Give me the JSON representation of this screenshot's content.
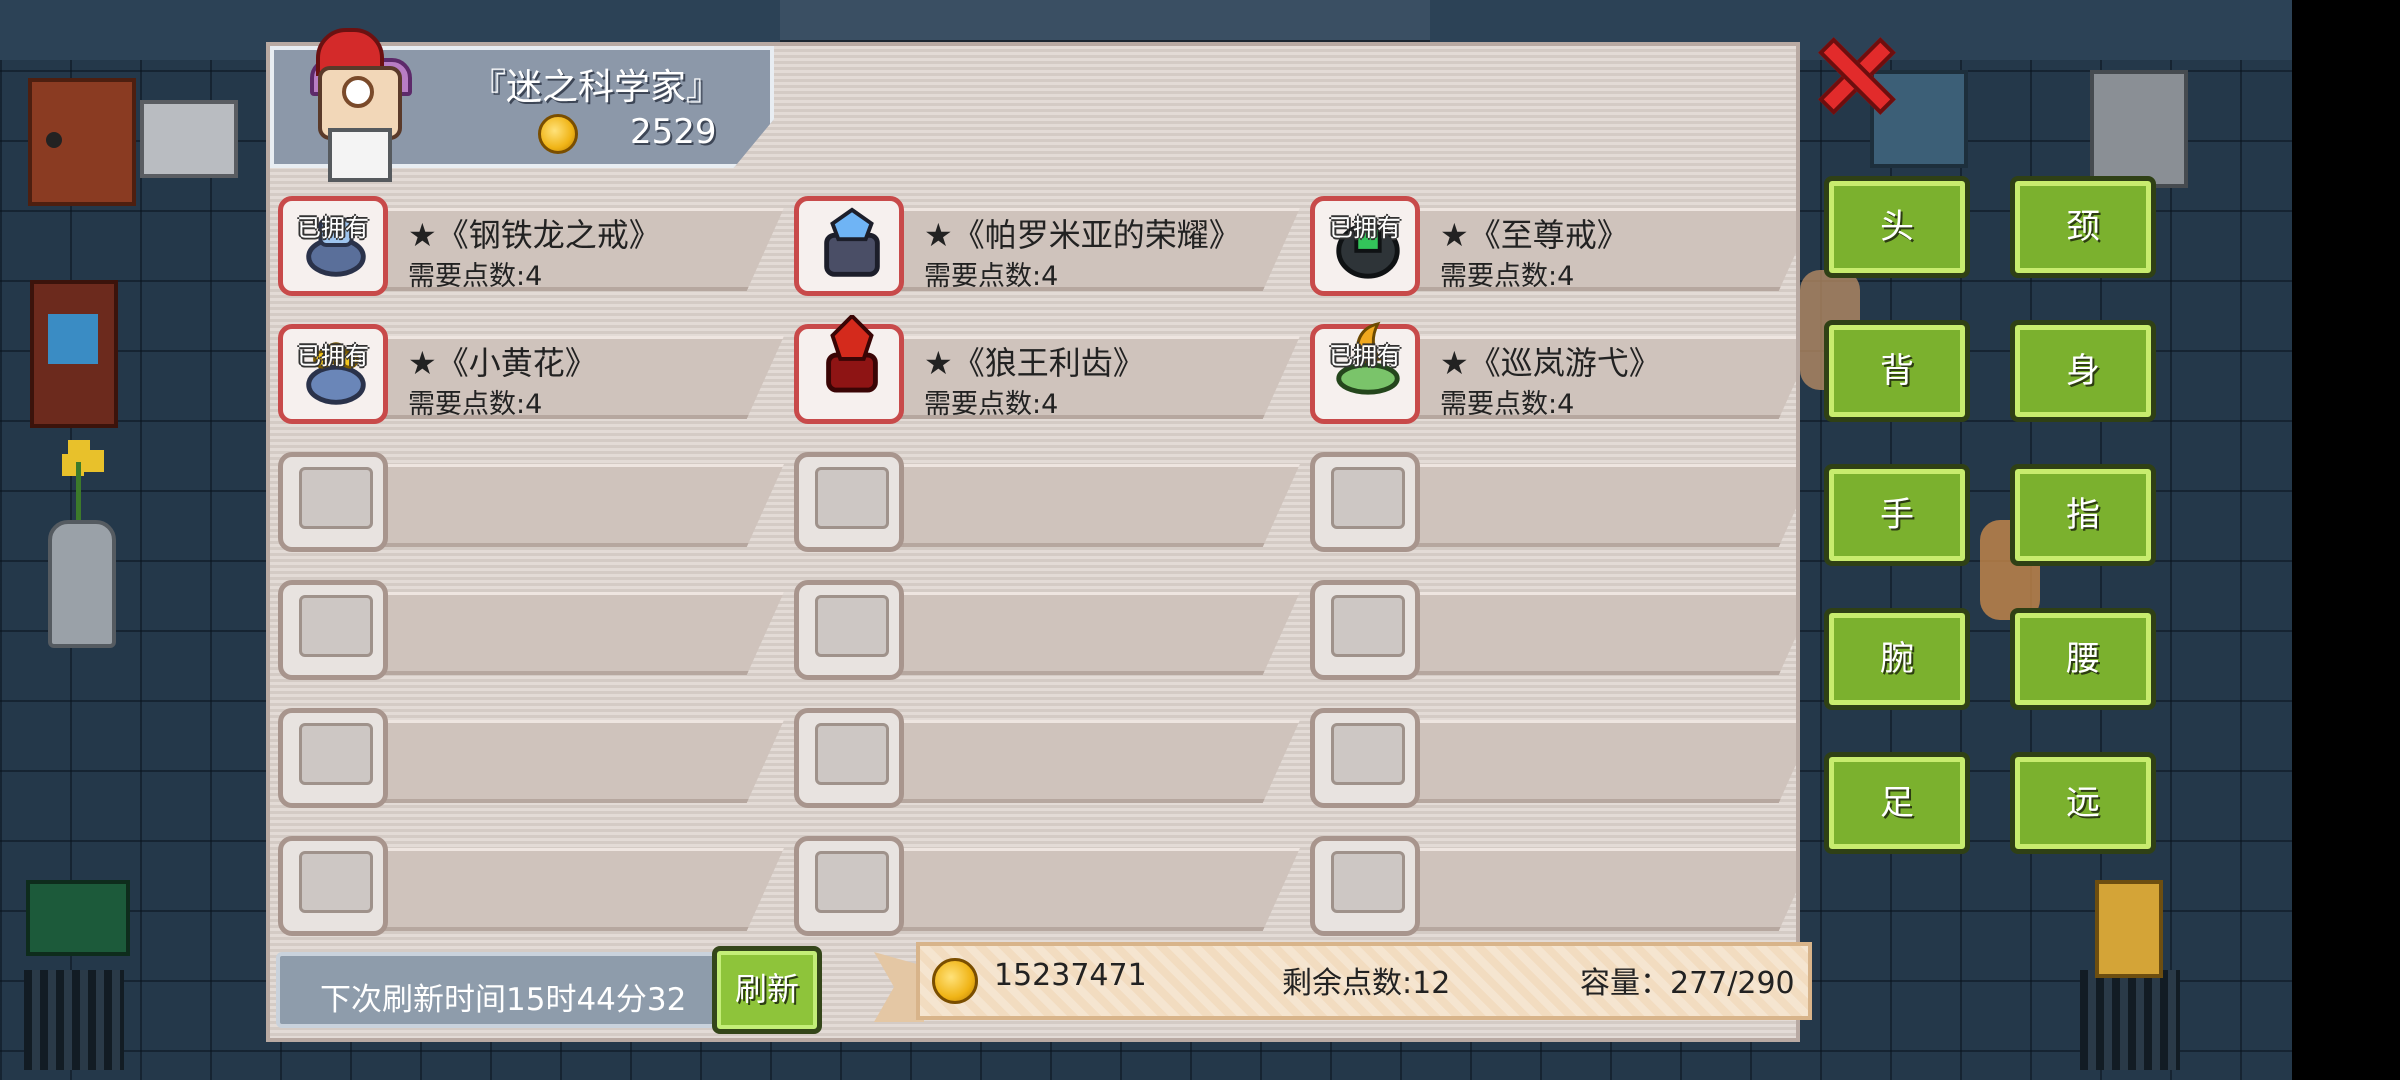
{
  "header": {
    "title": "『迷之科学家』",
    "gold": "2529"
  },
  "items": [
    {
      "name": "★《钢铁龙之戒》",
      "req": "需要点数:4",
      "owned_label": "已拥有",
      "owned": true,
      "icon": "steel-dragon-ring-icon",
      "color": "#7aa6d8"
    },
    {
      "name": "★《帕罗米亚的荣耀》",
      "req": "需要点数:4",
      "owned_label": "",
      "owned": false,
      "icon": "palomia-glory-ring-icon",
      "color": "#5f9ae0"
    },
    {
      "name": "★《至尊戒》",
      "req": "需要点数:4",
      "owned_label": "已拥有",
      "owned": true,
      "icon": "supreme-ring-icon",
      "color": "#2ea84a"
    },
    {
      "name": "★《小黄花》",
      "req": "需要点数:4",
      "owned_label": "已拥有",
      "owned": true,
      "icon": "little-yellow-flower-ring-icon",
      "color": "#f2c21c"
    },
    {
      "name": "★《狼王利齿》",
      "req": "需要点数:4",
      "owned_label": "",
      "owned": false,
      "icon": "wolf-king-fang-ring-icon",
      "color": "#c42a1e"
    },
    {
      "name": "★《巡岚游弋》",
      "req": "需要点数:4",
      "owned_label": "已拥有",
      "owned": true,
      "icon": "patrol-storm-ring-icon",
      "color": "#f0a81e"
    }
  ],
  "footer": {
    "timer": "下次刷新时间15时44分32",
    "refresh_label": "刷新",
    "gold": "15237471",
    "points": "剩余点数:12",
    "capacity": "容量：277/290"
  },
  "categories": {
    "head": "头",
    "neck": "颈",
    "back": "背",
    "body": "身",
    "hand": "手",
    "finger": "指",
    "wrist": "腕",
    "waist": "腰",
    "foot": "足",
    "ranged": "远"
  },
  "colors": {
    "panel": "#ddd3cd",
    "button_green": "#7bb12e",
    "close_red": "#e22b2b",
    "gold": "#f0b416"
  }
}
